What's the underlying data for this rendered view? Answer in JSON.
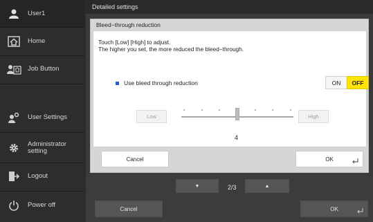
{
  "sidebar": {
    "user": "User1",
    "items": [
      {
        "label": "Home",
        "icon": "home-icon"
      },
      {
        "label": "Job Button",
        "icon": "job-button-icon"
      },
      {
        "label": "User Settings",
        "icon": "user-settings-icon"
      },
      {
        "label": "Administrator setting",
        "icon": "gear-icon"
      },
      {
        "label": "Logout",
        "icon": "logout-icon"
      },
      {
        "label": "Power off",
        "icon": "power-icon"
      }
    ]
  },
  "main": {
    "header": "Detailed settings",
    "pager": "2/3",
    "cancel": "Cancel",
    "ok": "OK"
  },
  "dialog": {
    "title": "Bleed−through reduction",
    "instruction_line1": "Touch [Low] [High] to adjust.",
    "instruction_line2": "The higher you set, the more reduced the bleed−through.",
    "option_label": "Use bleed through reduction",
    "on": "ON",
    "off": "OFF",
    "toggle_selected": "OFF",
    "low": "Low",
    "high": "High",
    "level_value": "4",
    "slider": {
      "min": 1,
      "max": 7,
      "value": 4
    },
    "cancel": "Cancel",
    "ok": "OK"
  },
  "colors": {
    "accent_yellow": "#ffe500",
    "marker_blue": "#1f63c8",
    "sidebar_bg": "#2d2d2d"
  }
}
